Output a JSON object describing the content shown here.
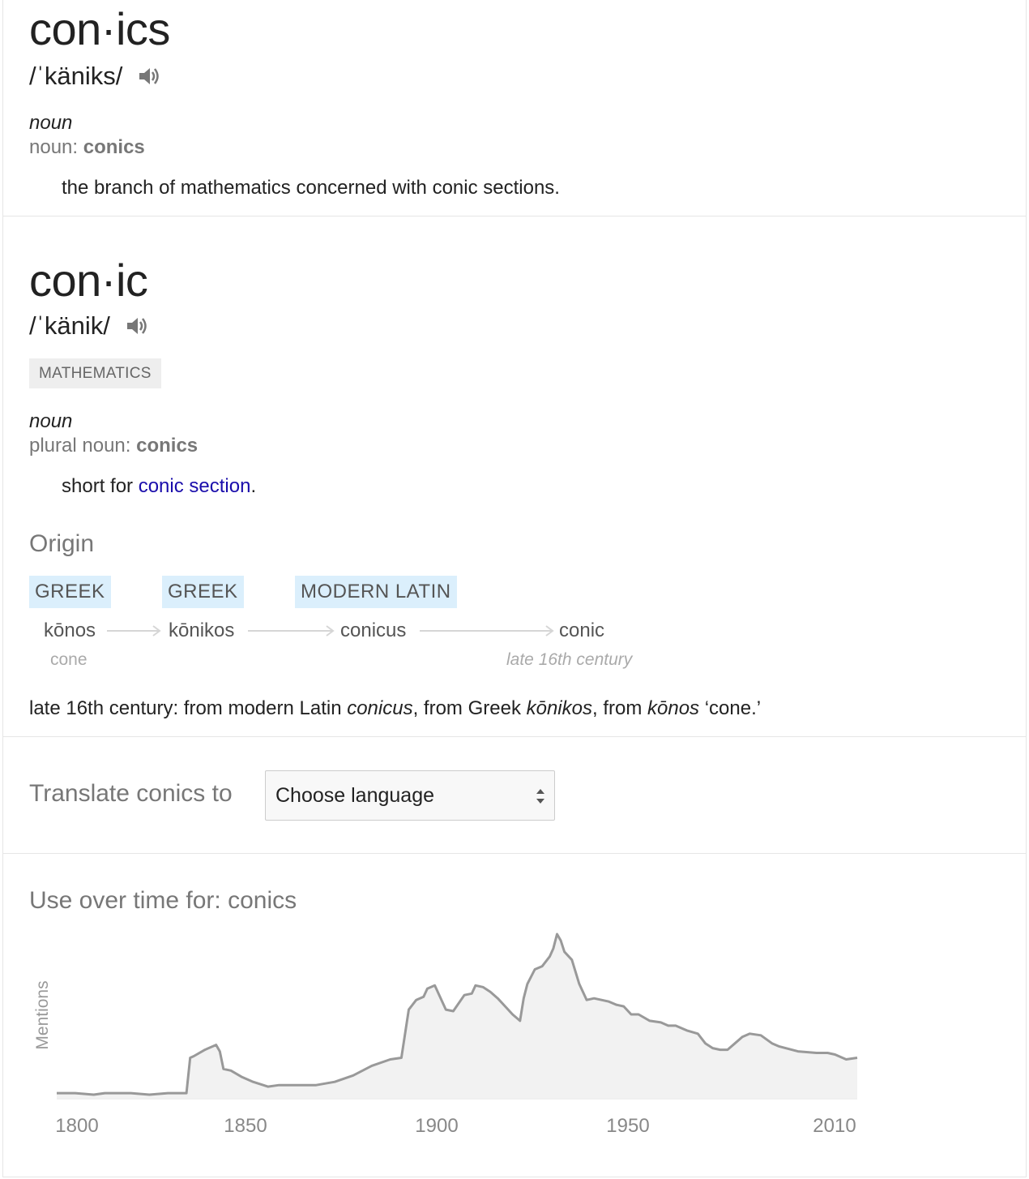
{
  "entry1": {
    "headword": "con·ics",
    "pronunciation": "/ˈkäniks/",
    "pos": "noun",
    "gram_label": "noun:",
    "gram_word": "conics",
    "definition": "the branch of mathematics concerned with conic sections."
  },
  "entry2": {
    "headword": "con·ic",
    "pronunciation": "/ˈkänik/",
    "subject_tag": "MATHEMATICS",
    "pos": "noun",
    "gram_label": "plural noun:",
    "gram_word": "conics",
    "definition_prefix": "short for",
    "definition_link": "conic section",
    "definition_suffix": "."
  },
  "origin": {
    "title": "Origin",
    "languages": [
      "GREEK",
      "GREEK",
      "MODERN LATIN"
    ],
    "words": [
      "kōnos",
      "kōnikos",
      "conicus",
      "conic"
    ],
    "gloss_first": "cone",
    "gloss_last": "late 16th century",
    "note": {
      "p1": "late 16th century: from modern Latin ",
      "w1": "conicus",
      "p2": ", from Greek ",
      "w2": "kōnikos",
      "p3": ", from ",
      "w3": "kōnos",
      "p4": " ‘cone.’"
    }
  },
  "translate": {
    "label": "Translate conics to",
    "select_value": "Choose language"
  },
  "usage": {
    "title": "Use over time for: conics"
  },
  "chart_data": {
    "type": "area",
    "title": "Use over time for: conics",
    "xlabel": "",
    "ylabel": "Mentions",
    "xlim": [
      1800,
      2010
    ],
    "x_ticks": [
      1800,
      1850,
      1900,
      1950,
      2010
    ],
    "y_ticks_shown": false,
    "grid": false,
    "series": [
      {
        "x": [
          1795,
          1800,
          1805,
          1808,
          1815,
          1820,
          1825,
          1827,
          1830,
          1831,
          1832,
          1835,
          1838,
          1839,
          1840,
          1842,
          1845,
          1848,
          1852,
          1855,
          1858,
          1860,
          1865,
          1870,
          1875,
          1880,
          1885,
          1888,
          1890,
          1892,
          1894,
          1895,
          1897,
          1900,
          1902,
          1905,
          1907,
          1908,
          1910,
          1912,
          1914,
          1916,
          1918,
          1920,
          1921,
          1922,
          1924,
          1926,
          1928,
          1929,
          1930,
          1931,
          1932,
          1934,
          1936,
          1938,
          1940,
          1942,
          1944,
          1946,
          1948,
          1950,
          1952,
          1955,
          1958,
          1960,
          1962,
          1965,
          1968,
          1970,
          1972,
          1974,
          1976,
          1978,
          1980,
          1982,
          1985,
          1988,
          1990,
          1995,
          2000,
          2003,
          2005,
          2008,
          2011
        ],
        "y": [
          3,
          3,
          2,
          3,
          3,
          2,
          3,
          3,
          3,
          25,
          26,
          30,
          33,
          29,
          18,
          17,
          13,
          10,
          7,
          8,
          8,
          8,
          8,
          10,
          14,
          20,
          24,
          25,
          55,
          61,
          63,
          68,
          70,
          55,
          54,
          64,
          65,
          70,
          69,
          66,
          62,
          57,
          52,
          48,
          62,
          71,
          80,
          82,
          88,
          93,
          102,
          98,
          91,
          86,
          71,
          61,
          62,
          61,
          60,
          58,
          57,
          52,
          52,
          48,
          47,
          45,
          45,
          42,
          40,
          34,
          31,
          30,
          30,
          34,
          38,
          40,
          39,
          34,
          32,
          29,
          28,
          28,
          27,
          24,
          25
        ]
      }
    ]
  }
}
